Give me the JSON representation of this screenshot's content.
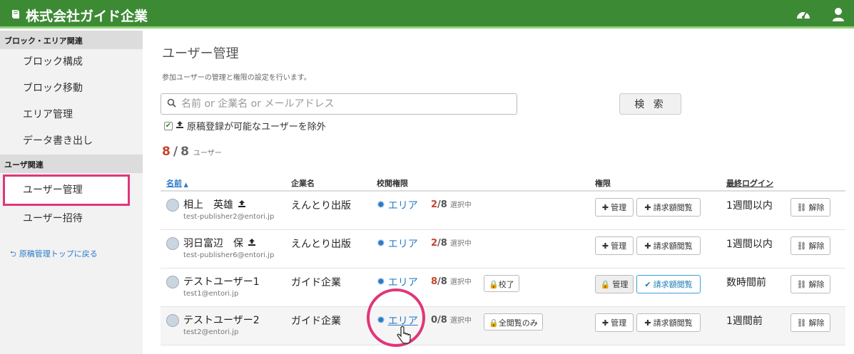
{
  "header": {
    "title": "株式会社ガイド企業",
    "book_icon": "book-icon",
    "dashboard_icon": "dashboard-icon",
    "user_icon": "user-icon",
    "color": "#3d8a35"
  },
  "sidebar": {
    "section1": "ブロック・エリア関連",
    "items1": [
      {
        "label": "ブロック構成"
      },
      {
        "label": "ブロック移動"
      },
      {
        "label": "エリア管理"
      },
      {
        "label": "データ書き出し"
      }
    ],
    "section2": "ユーザ関連",
    "items2": [
      {
        "label": "ユーザー管理",
        "active": true
      },
      {
        "label": "ユーザー招待"
      }
    ],
    "back_link": "原稿管理トップに戻る"
  },
  "main": {
    "title": "ユーザー管理",
    "description": "参加ユーザーの管理と権限の設定を行います。",
    "search_placeholder": "名前 or 企業名 or メールアドレス",
    "search_button": "検 索",
    "exclude_label": "原稿登録が可能なユーザーを除外",
    "exclude_checked": true,
    "count_shown": "8",
    "count_sep": "/",
    "count_total": "8",
    "count_unit": "ユーザー"
  },
  "table": {
    "headers": {
      "name": "名前",
      "sort_indicator": "▲",
      "company": "企業名",
      "proof": "校閲権限",
      "perm": "権限",
      "last_login": "最終ログイン"
    },
    "rows": [
      {
        "name": "相上　英雄",
        "email": "test-publisher2@entori.jp",
        "company": "えんとり出版",
        "area_label": "エリア",
        "sel_count": "2",
        "sel_total": "/8",
        "sel_suffix": "選択中",
        "tag": "",
        "manage": "管理",
        "billing": "請求額閲覧",
        "last_login": "1週間以内",
        "unlink": "解除"
      },
      {
        "name": "羽日富辺　保",
        "email": "test-publisher6@entori.jp",
        "company": "えんとり出版",
        "area_label": "エリア",
        "sel_count": "2",
        "sel_total": "/8",
        "sel_suffix": "選択中",
        "tag": "",
        "manage": "管理",
        "billing": "請求額閲覧",
        "last_login": "1週間以内",
        "unlink": "解除"
      },
      {
        "name": "テストユーザー1",
        "email": "test1@entori.jp",
        "company": "ガイド企業",
        "area_label": "エリア",
        "sel_count": "8",
        "sel_total": "/8",
        "sel_suffix": "選択中",
        "tag": "校了",
        "manage": "管理",
        "billing": "請求額閲覧",
        "last_login": "数時間前",
        "unlink": "解除"
      },
      {
        "name": "テストユーザー2",
        "email": "test2@entori.jp",
        "company": "ガイド企業",
        "area_label": "エリア",
        "sel_count": "0",
        "sel_total": "/8",
        "sel_suffix": "選択中",
        "tag": "全閲覧のみ",
        "manage": "管理",
        "billing": "請求額閲覧",
        "last_login": "1週間前",
        "unlink": "解除"
      }
    ]
  },
  "icons": {
    "plus": "+",
    "lock": "🔒",
    "check": "✔",
    "gear": "✹",
    "link": "⛓",
    "upload": "⇪",
    "search": "⌕"
  }
}
